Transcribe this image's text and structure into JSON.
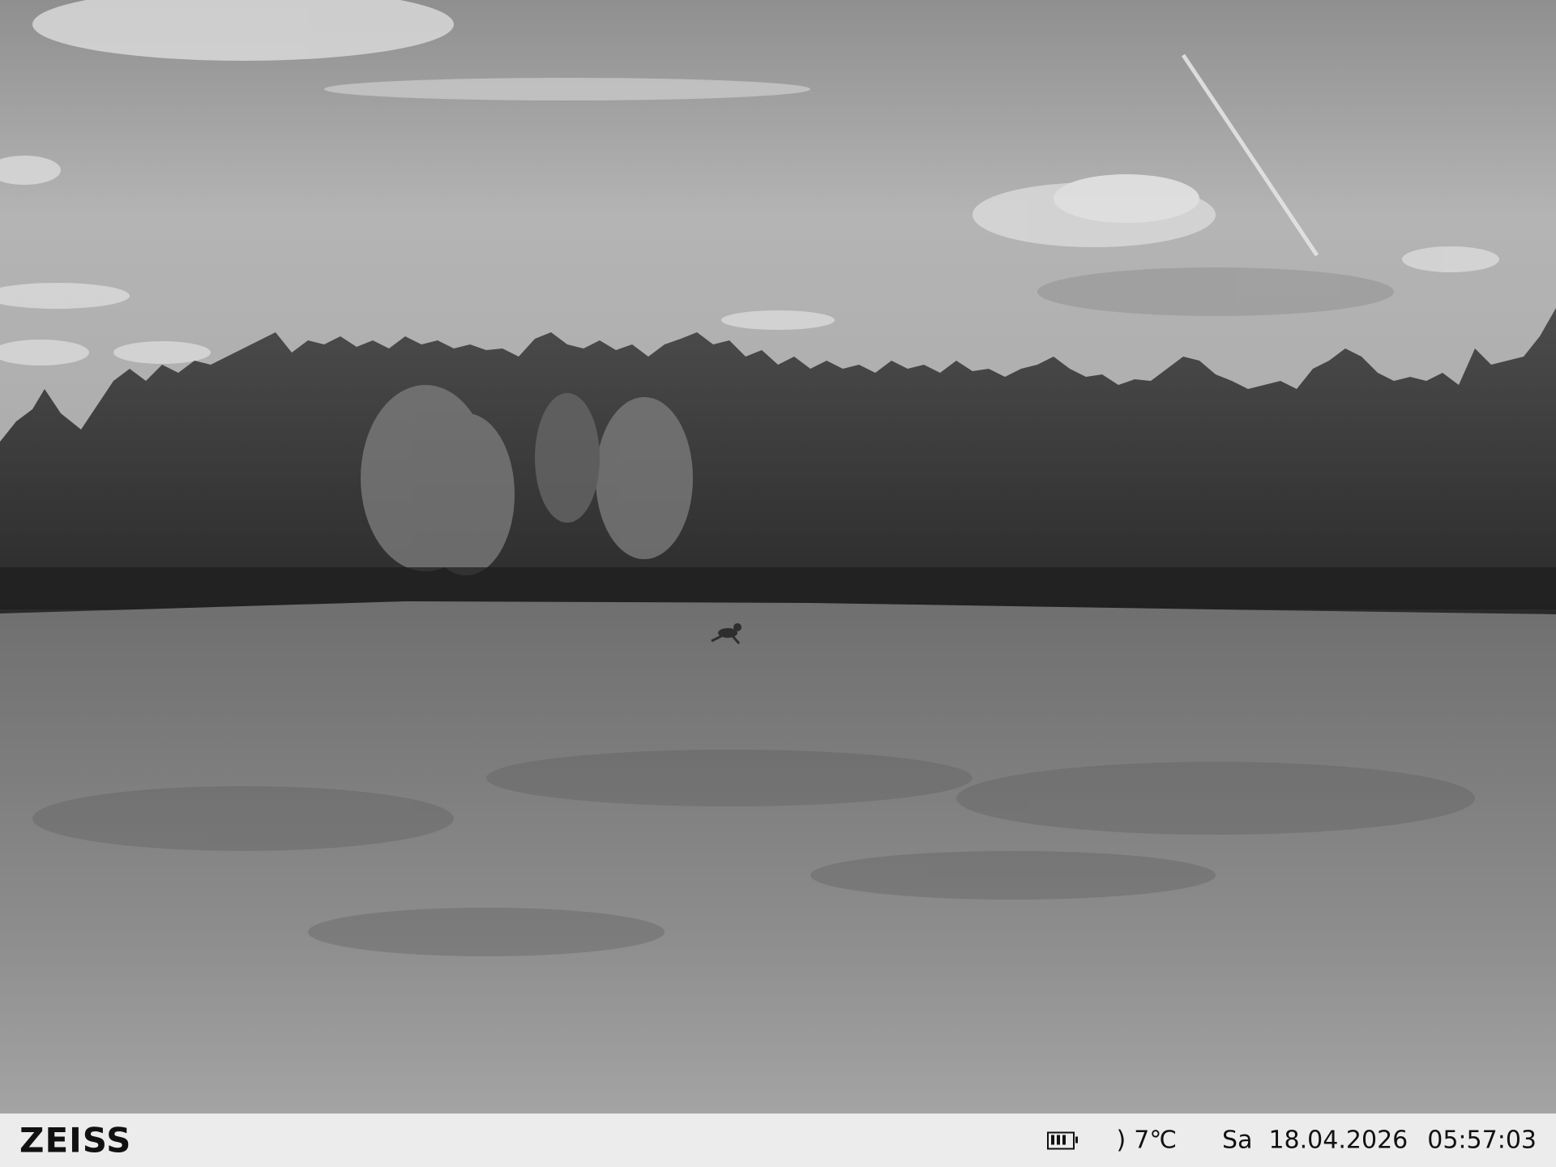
{
  "camera": {
    "brand": "ZEISS",
    "overlay": {
      "battery_icon": "battery-icon",
      "moon_icon": "moon-phase-icon",
      "moon_glyph": ")",
      "temperature": "7℃",
      "weekday": "Sa",
      "date": "18.04.2026",
      "time": "05:57:03"
    }
  },
  "scene": {
    "mode": "infrared grayscale",
    "subjects": [
      "sky with clouds",
      "contrail",
      "conifer forest edge",
      "meadow",
      "animal in field"
    ]
  }
}
